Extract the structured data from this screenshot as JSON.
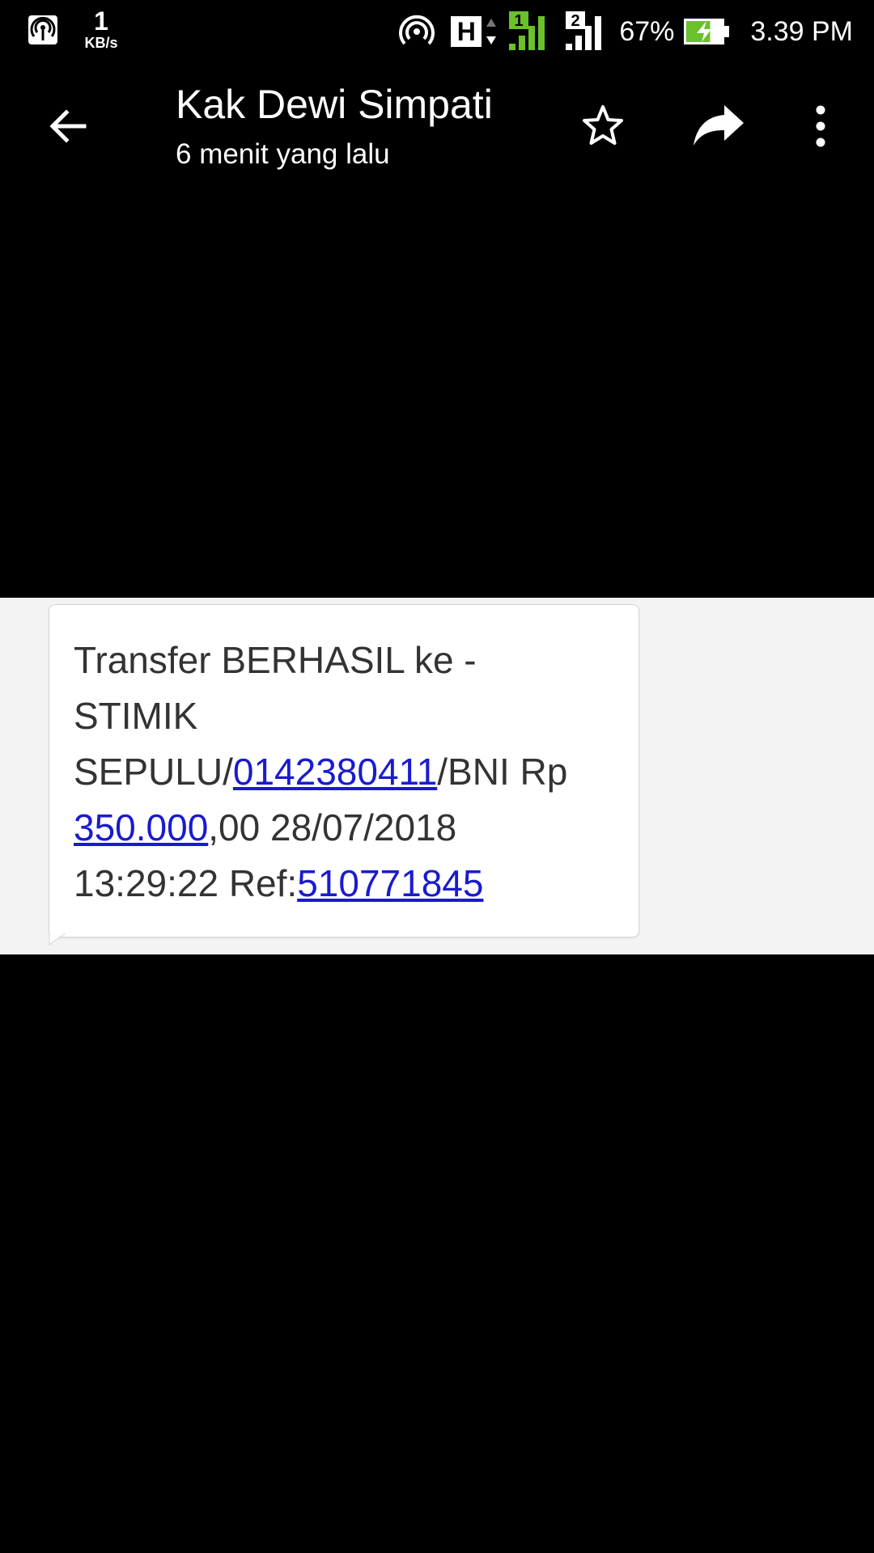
{
  "status_bar": {
    "speed_value": "1",
    "speed_unit": "KB/s",
    "network_type": "H",
    "sim1_label": "1",
    "sim2_label": "2",
    "battery_percent": "67%",
    "battery_level": 0.67,
    "time": "3.39 PM",
    "icons": [
      "hotspot-icon",
      "hotspot-icon",
      "data-arrows-icon",
      "signal-sim1-icon",
      "signal-sim2-icon",
      "battery-charging-icon"
    ],
    "sim1_color": "#6ac12b",
    "battery_color": "#6ac12b"
  },
  "toolbar": {
    "title": "Kak Dewi Simpati",
    "subtitle": "6 menit yang lalu",
    "icons": [
      "back-arrow-icon",
      "star-icon",
      "reply-icon",
      "more-vert-icon"
    ]
  },
  "message": {
    "line1": "Transfer BERHASIL ke -",
    "line2": "STIMIK",
    "line3_prefix": "SEPULU/",
    "account_link": "0142380411",
    "line3_suffix": "/BNI Rp",
    "amount_link": "350.000",
    "line4_suffix": ",00 28/07/2018",
    "line5_prefix": "13:29:22 Ref:",
    "ref_link": "510771845",
    "link_color": "#1a1ad0"
  }
}
